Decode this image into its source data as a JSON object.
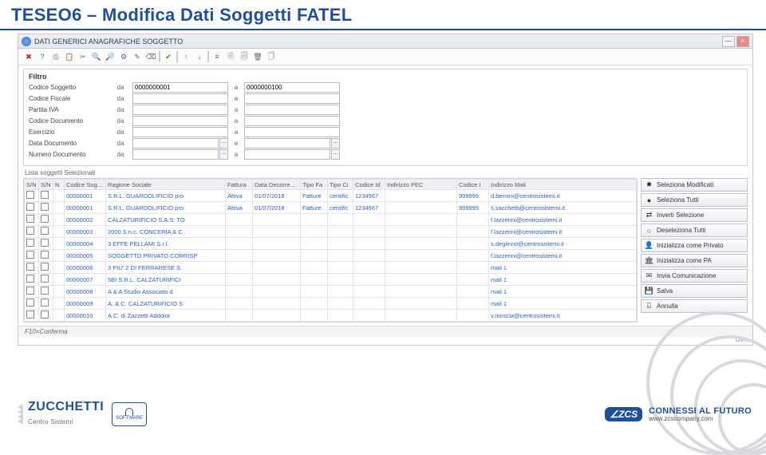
{
  "slide_title": "TESEO6 – Modifica Dati Soggetti FATEL",
  "window": {
    "title": "DATI GENERICI ANAGRAFICHE SOGGETTO",
    "minimize": "—",
    "close": "✕"
  },
  "toolbar": {
    "icons": [
      "✖",
      "?",
      "⎙",
      "📋",
      "✂",
      "🔍",
      "🔎",
      "⚙",
      "✎",
      "⌫",
      "✔",
      "↑",
      "↓",
      "|",
      "≡",
      "🗎",
      "🗐",
      "🗑",
      "🗍"
    ]
  },
  "filtro": {
    "title": "Filtro",
    "rows": [
      {
        "label": "Codice Soggetto",
        "op": "da",
        "v1": "0000000001",
        "op2": "a",
        "v2": "0000000100"
      },
      {
        "label": "Codice Fiscale",
        "op": "da",
        "v1": "",
        "op2": "a",
        "v2": ""
      },
      {
        "label": "Partita IVA",
        "op": "da",
        "v1": "",
        "op2": "a",
        "v2": ""
      },
      {
        "label": "Codice Documento",
        "op": "da",
        "v1": "",
        "op2": "a",
        "v2": ""
      },
      {
        "label": "Esercizio",
        "op": "da",
        "v1": "",
        "op2": "a",
        "v2": ""
      },
      {
        "label": "Data Documento",
        "op": "da",
        "v1": "",
        "op2": "a",
        "v2": ""
      },
      {
        "label": "Numero Documento",
        "op": "da",
        "v1": "",
        "op2": "a",
        "v2": ""
      }
    ]
  },
  "lista_label": "Lista soggetti Selezionati",
  "grid": {
    "headers": [
      "S/N",
      "S/N",
      "N",
      "Codice Sogge",
      "Ragione Sociale",
      "Fattura",
      "Data Decorrenza",
      "Tipo Fa",
      "Tipo Ci",
      "Codice Id",
      "Indirizzo PEC",
      "Codice I",
      "Indirizzo Mail"
    ],
    "rows": [
      {
        "cod": "00000001",
        "rag": "S.R.L. GUARDOLIFICIO pro",
        "fat": "Attiva",
        "data": "01/07/2018",
        "tipo": "Fatture",
        "cd": "centific",
        "cid": "1234567",
        "pec": "",
        "ci": "999999",
        "mail": "d.bernini@centrosistemi.it"
      },
      {
        "cod": "00000001",
        "rag": "S.R.L. GUARDOLIFICIO pro",
        "fat": "Attiva",
        "data": "01/07/2018",
        "tipo": "Fatture",
        "cd": "centific",
        "cid": "1234567",
        "pec": "",
        "ci": "999999",
        "mail": "s.sacchetti@centrosistemi.it"
      },
      {
        "cod": "00000002",
        "rag": "CALZATURIFICIO S.A.S. TO",
        "fat": "",
        "data": "",
        "tipo": "",
        "cd": "",
        "cid": "",
        "pec": "",
        "ci": "",
        "mail": "f.lazzerini@centrosistemi.it"
      },
      {
        "cod": "00000003",
        "rag": "2000 S.n.c. CONCERIA & C",
        "fat": "",
        "data": "",
        "tipo": "",
        "cd": "",
        "cid": "",
        "pec": "",
        "ci": "",
        "mail": "f.lazzerini@centrosistemi.it"
      },
      {
        "cod": "00000004",
        "rag": "3 EFFE PELLAMI S.r.l.",
        "fat": "",
        "data": "",
        "tipo": "",
        "cd": "",
        "cid": "",
        "pec": "",
        "ci": "",
        "mail": "s.degiinno@centrosistemi.it"
      },
      {
        "cod": "00000005",
        "rag": "SOGGETTO PRIVATO CORRISP",
        "fat": "",
        "data": "",
        "tipo": "",
        "cd": "",
        "cid": "",
        "pec": "",
        "ci": "",
        "mail": "f.lazzerini@centrosistemi.it"
      },
      {
        "cod": "00000006",
        "rag": "3 PIU' 2 DI FERRARESE S.",
        "fat": "",
        "data": "",
        "tipo": "",
        "cd": "",
        "cid": "",
        "pec": "",
        "ci": "",
        "mail": "mail 1"
      },
      {
        "cod": "00000007",
        "rag": "5BI S.R.L. CALZATURIFICI",
        "fat": "",
        "data": "",
        "tipo": "",
        "cd": "",
        "cid": "",
        "pec": "",
        "ci": "",
        "mail": "mail 1"
      },
      {
        "cod": "00000008",
        "rag": "A & A Studio Associato d",
        "fat": "",
        "data": "",
        "tipo": "",
        "cd": "",
        "cid": "",
        "pec": "",
        "ci": "",
        "mail": "mail 1"
      },
      {
        "cod": "00000009",
        "rag": "A. & C. CALZATURIFICIO S",
        "fat": "",
        "data": "",
        "tipo": "",
        "cd": "",
        "cid": "",
        "pec": "",
        "ci": "",
        "mail": "mail 1"
      },
      {
        "cod": "00000010",
        "rag": "A.C. di Zazzetti Addolor",
        "fat": "",
        "data": "",
        "tipo": "",
        "cd": "",
        "cid": "",
        "pec": "",
        "ci": "",
        "mail": "v.moscia@centrosistemi.it"
      }
    ]
  },
  "side_buttons": [
    {
      "icon": "✸",
      "label": "Seleziona Modificati"
    },
    {
      "icon": "●",
      "label": "Seleziona Tutti"
    },
    {
      "icon": "⇄",
      "label": "Inverti Selezione"
    },
    {
      "icon": "○",
      "label": "Deseleziona Tutti"
    },
    {
      "icon": "👤",
      "label": "Inizializza come Privato"
    },
    {
      "icon": "🏛",
      "label": "Inizializza come PA"
    },
    {
      "icon": "✉",
      "label": "Invia Comunicazione"
    },
    {
      "icon": "💾",
      "label": "Salva"
    },
    {
      "icon": "⍇",
      "label": "Annulla"
    }
  ],
  "status": "F10=Conferma",
  "status_r": "OVR",
  "footer": {
    "zucchetti": "ZUCCHETTI",
    "zucchetti_sub": "Centro Sistemi",
    "badge": "SOFTWARE",
    "zcs": "∠ZCS",
    "tag1": "CONNESSI AL FUTURO",
    "tag2": "www.zcscompany.com"
  }
}
